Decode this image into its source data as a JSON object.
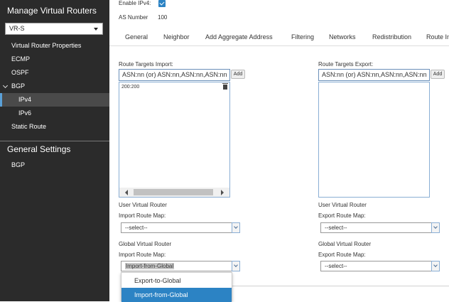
{
  "sidebar": {
    "title": "Manage Virtual Routers",
    "router_select": "VR-S",
    "items": [
      {
        "label": "Virtual Router Properties"
      },
      {
        "label": "ECMP"
      },
      {
        "label": "OSPF"
      },
      {
        "label": "BGP"
      },
      {
        "label": "IPv4"
      },
      {
        "label": "IPv6"
      },
      {
        "label": "Static Route"
      }
    ],
    "section2_title": "General Settings",
    "section2_items": [
      {
        "label": "BGP"
      }
    ]
  },
  "header": {
    "enable_ipv4_label": "Enable IPv4:",
    "enable_ipv4_checked": true,
    "as_number_label": "AS Number",
    "as_number_value": "100"
  },
  "tabs": [
    {
      "label": "General"
    },
    {
      "label": "Neighbor"
    },
    {
      "label": "Add Aggregate Address"
    },
    {
      "label": "Filtering"
    },
    {
      "label": "Networks"
    },
    {
      "label": "Redistribution"
    },
    {
      "label": "Route In"
    }
  ],
  "import": {
    "label": "Route Targets Import:",
    "input_placeholder": "ASN:nn (or) ASN:nn,ASN:nn,ASN:nn",
    "add_label": "Add",
    "entries": [
      "200:200"
    ]
  },
  "export": {
    "label": "Route Targets Export:",
    "input_placeholder": "ASN:nn (or) ASN:nn,ASN:nn,ASN:nn",
    "add_label": "Add"
  },
  "user_vr": {
    "left_heading": "User Virtual Router",
    "left_label": "Import Route Map:",
    "left_value": "--select--",
    "right_heading": "User Virtual Router",
    "right_label": "Export Route Map:",
    "right_value": "--select--"
  },
  "global_vr": {
    "left_heading": "Global Virtual Router",
    "left_label": "Import Route Map:",
    "left_value": "Import-from-Global",
    "right_heading": "Global Virtual Router",
    "right_label": "Export Route Map:",
    "right_value": "--select--"
  },
  "dropdown": {
    "options": [
      "Export-to-Global",
      "Import-from-Global"
    ],
    "selected": "Import-from-Global"
  },
  "colors": {
    "sidebar_bg": "#2b2b2b",
    "accent": "#2c83c4"
  }
}
